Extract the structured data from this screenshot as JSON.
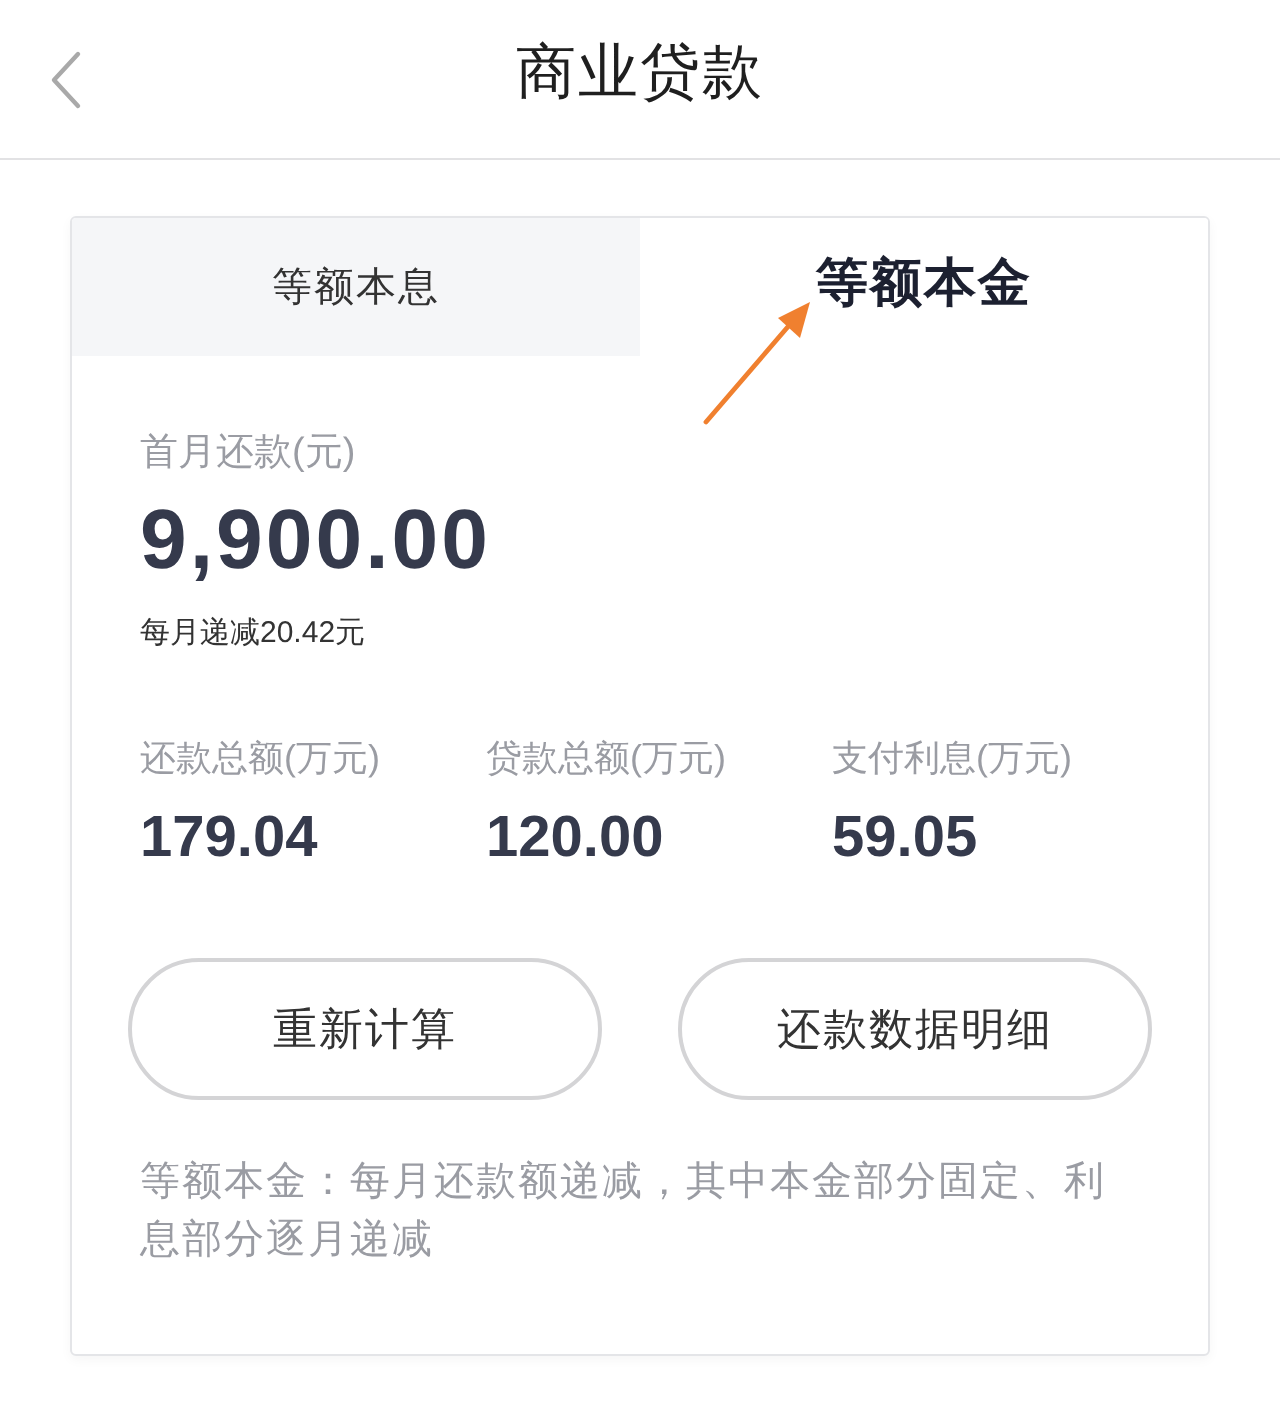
{
  "header": {
    "title": "商业贷款"
  },
  "tabs": [
    {
      "label": "等额本息",
      "selected": false
    },
    {
      "label": "等额本金",
      "selected": true
    }
  ],
  "first_payment": {
    "label": "首月还款(元)",
    "amount": "9,900.00",
    "note": "每月递减20.42元"
  },
  "stats": [
    {
      "label": "还款总额(万元)",
      "value": "179.04"
    },
    {
      "label": "贷款总额(万元)",
      "value": "120.00"
    },
    {
      "label": "支付利息(万元)",
      "value": "59.05"
    }
  ],
  "buttons": [
    "重新计算",
    "还款数据明细"
  ],
  "description": "等额本金：每月还款额递减，其中本金部分固定、利息部分逐月递减"
}
